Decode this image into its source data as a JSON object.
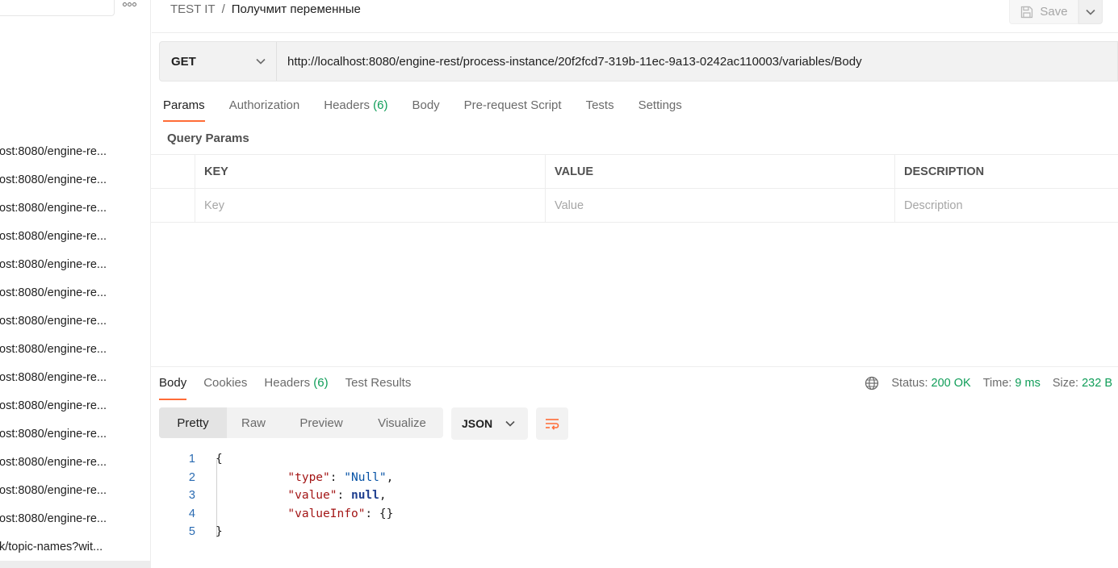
{
  "sidebar": {
    "items": [
      {
        "label": "ost:8080/engine-re..."
      },
      {
        "label": "ost:8080/engine-re..."
      },
      {
        "label": "ost:8080/engine-re..."
      },
      {
        "label": "ost:8080/engine-re..."
      },
      {
        "label": "ost:8080/engine-re..."
      },
      {
        "label": "ost:8080/engine-re..."
      },
      {
        "label": "ost:8080/engine-re..."
      },
      {
        "label": "ost:8080/engine-re..."
      },
      {
        "label": "ost:8080/engine-re..."
      },
      {
        "label": "ost:8080/engine-re..."
      },
      {
        "label": "ost:8080/engine-re..."
      },
      {
        "label": "ost:8080/engine-re..."
      },
      {
        "label": "ost:8080/engine-re..."
      },
      {
        "label": "ost:8080/engine-re..."
      },
      {
        "label": "k/topic-names?wit..."
      }
    ]
  },
  "header": {
    "collection": "TEST IT",
    "separator": "/",
    "request_name": "Получмит переменные",
    "save_label": "Save"
  },
  "request": {
    "method": "GET",
    "url": "http://localhost:8080/engine-rest/process-instance/20f2fcd7-319b-11ec-9a13-0242ac110003/variables/Body",
    "tabs": {
      "params": "Params",
      "authorization": "Authorization",
      "headers": "Headers",
      "headers_count": "(6)",
      "body": "Body",
      "prerequest": "Pre-request Script",
      "tests": "Tests",
      "settings": "Settings"
    },
    "query_params_title": "Query Params",
    "table": {
      "headers": {
        "key": "KEY",
        "value": "VALUE",
        "description": "DESCRIPTION"
      },
      "placeholders": {
        "key": "Key",
        "value": "Value",
        "description": "Description"
      }
    }
  },
  "response": {
    "tabs": {
      "body": "Body",
      "cookies": "Cookies",
      "headers": "Headers",
      "headers_count": "(6)",
      "test_results": "Test Results"
    },
    "status_label": "Status:",
    "status_value": "200 OK",
    "time_label": "Time:",
    "time_value": "9 ms",
    "size_label": "Size:",
    "size_value": "232 B",
    "views": {
      "pretty": "Pretty",
      "raw": "Raw",
      "preview": "Preview",
      "visualize": "Visualize"
    },
    "format": "JSON",
    "code": {
      "line_numbers": [
        "1",
        "2",
        "3",
        "4",
        "5"
      ],
      "open_brace": "{",
      "close_brace": "}",
      "type_key": "\"type\"",
      "type_value": "\"Null\"",
      "value_key": "\"value\"",
      "value_value": "null",
      "valueinfo_key": "\"valueInfo\"",
      "valueinfo_value": "{}",
      "colon": ": ",
      "comma": ","
    }
  },
  "colors": {
    "accent": "#ff6c37",
    "success": "#0f9d58",
    "json_key": "#a31515",
    "json_string": "#0451a5"
  }
}
